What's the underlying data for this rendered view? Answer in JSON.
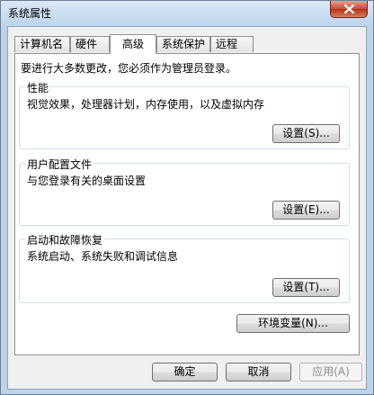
{
  "window": {
    "title": "系统属性"
  },
  "tabs": [
    {
      "label": "计算机名"
    },
    {
      "label": "硬件"
    },
    {
      "label": "高级"
    },
    {
      "label": "系统保护"
    },
    {
      "label": "远程"
    }
  ],
  "active_tab": "高级",
  "notice": "要进行大多数更改，您必须作为管理员登录。",
  "performance": {
    "title": "性能",
    "description": "视觉效果，处理器计划，内存使用，以及虚拟内存",
    "settings_label": "设置(S)..."
  },
  "user_profiles": {
    "title": "用户配置文件",
    "description": "与您登录有关的桌面设置",
    "settings_label": "设置(E)..."
  },
  "startup_recovery": {
    "title": "启动和故障恢复",
    "description": "系统启动、系统失败和调试信息",
    "settings_label": "设置(T)..."
  },
  "env_button_label": "环境变量(N)...",
  "footer": {
    "ok_label": "确定",
    "cancel_label": "取消",
    "apply_label": "应用(A)"
  }
}
